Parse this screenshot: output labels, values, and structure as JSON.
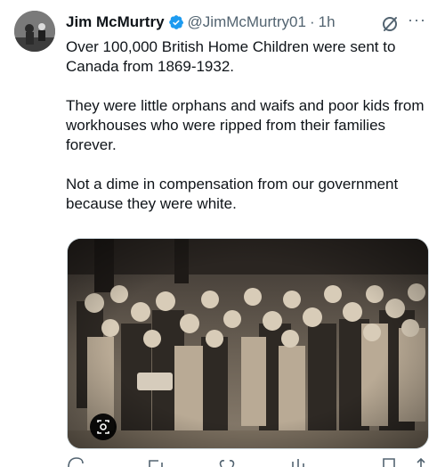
{
  "post": {
    "author": {
      "name": "Jim McMurtry",
      "handle": "@JimMcMurtry01",
      "verified": true,
      "avatar_icon": "avatar-photo"
    },
    "separator": "·",
    "time": "1h",
    "paragraphs": [
      "Over 100,000 British Home Children were sent to Canada from 1869-1932.",
      "They were little orphans and waifs and poor kids from workhouses who were ripped from their families forever.",
      "Not a dime in compensation from our government because they were white."
    ],
    "media": {
      "icon": "photo",
      "badge_icon": "grok-analyze-icon"
    },
    "menu_icons": [
      "grok-icon",
      "more-icon"
    ],
    "more_glyph": "···",
    "actions": [
      "reply-icon",
      "repost-icon",
      "like-icon",
      "views-icon",
      "bookmark-icon",
      "share-icon"
    ]
  },
  "colors": {
    "verified_blue": "#1d9bf0",
    "secondary_text": "#536471",
    "primary_text": "#0f1419",
    "border": "#cfd9de"
  }
}
